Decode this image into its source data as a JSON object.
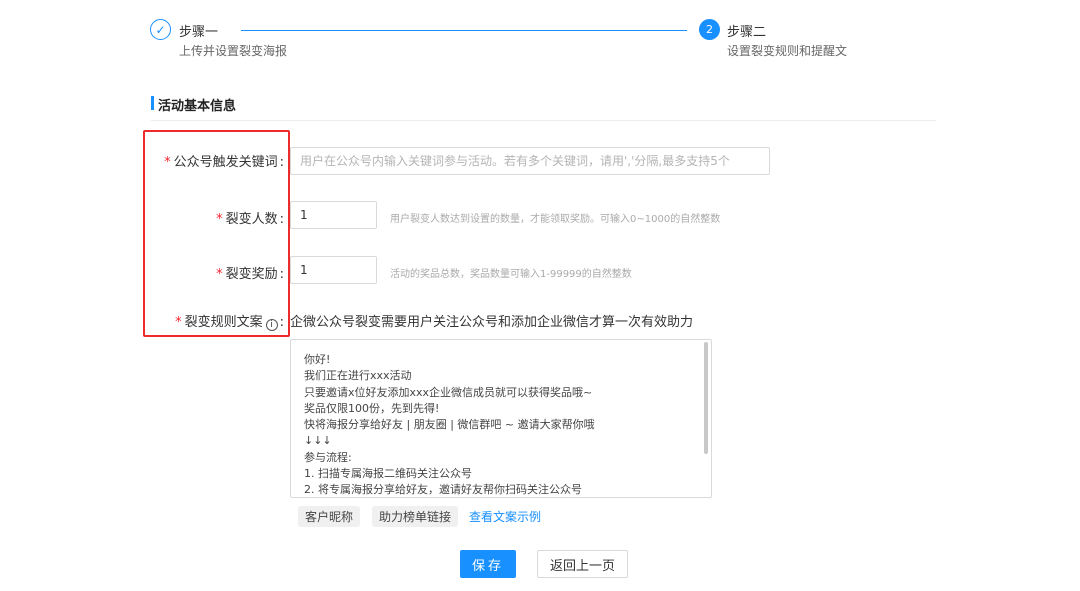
{
  "steps": [
    {
      "title": "步骤一",
      "desc": "上传并设置裂变海报",
      "status": "done"
    },
    {
      "title": "步骤二",
      "desc": "设置裂变规则和提醒文",
      "status": "active",
      "number": "2"
    }
  ],
  "section": {
    "title": "活动基本信息"
  },
  "form": {
    "required_mark": "*",
    "keyword": {
      "label": "公众号触发关键词",
      "placeholder": "用户在公众号内输入关键词参与活动。若有多个关键词，请用','分隔,最多支持5个"
    },
    "fission_count": {
      "label": "裂变人数",
      "value": "1",
      "hint": "用户裂变人数达到设置的数量，才能领取奖励。可输入0~1000的自然整数"
    },
    "reward": {
      "label": "裂变奖励",
      "value": "1",
      "hint": "活动的奖品总数，奖品数量可输入1-99999的自然整数"
    },
    "rule_text": {
      "label": "裂变规则文案",
      "info_icon": "info-circle-icon",
      "description": "企微公众号裂变需要用户关注公众号和添加企业微信才算一次有效助力",
      "lines": [
        "你好!",
        "我们正在进行xxx活动",
        "只要邀请x位好友添加xxx企业微信成员就可以获得奖品哦~",
        "奖品仅限100份，先到先得!",
        "快将海报分享给好友 | 朋友圈 | 微信群吧 ~ 邀请大家帮你哦",
        "↓↓↓",
        "参与流程:",
        "1. 扫描专属海报二维码关注公众号",
        "2. 将专属海报分享给好友，邀请好友帮你扫码关注公众号"
      ]
    },
    "tags": [
      "客户昵称",
      "助力榜单链接"
    ],
    "example_link": "查看文案示例"
  },
  "actions": {
    "save": "保存",
    "back": "返回上一页"
  },
  "colors": {
    "primary": "#1890ff",
    "highlight": "#ee2b2b",
    "required": "#f5222d"
  }
}
